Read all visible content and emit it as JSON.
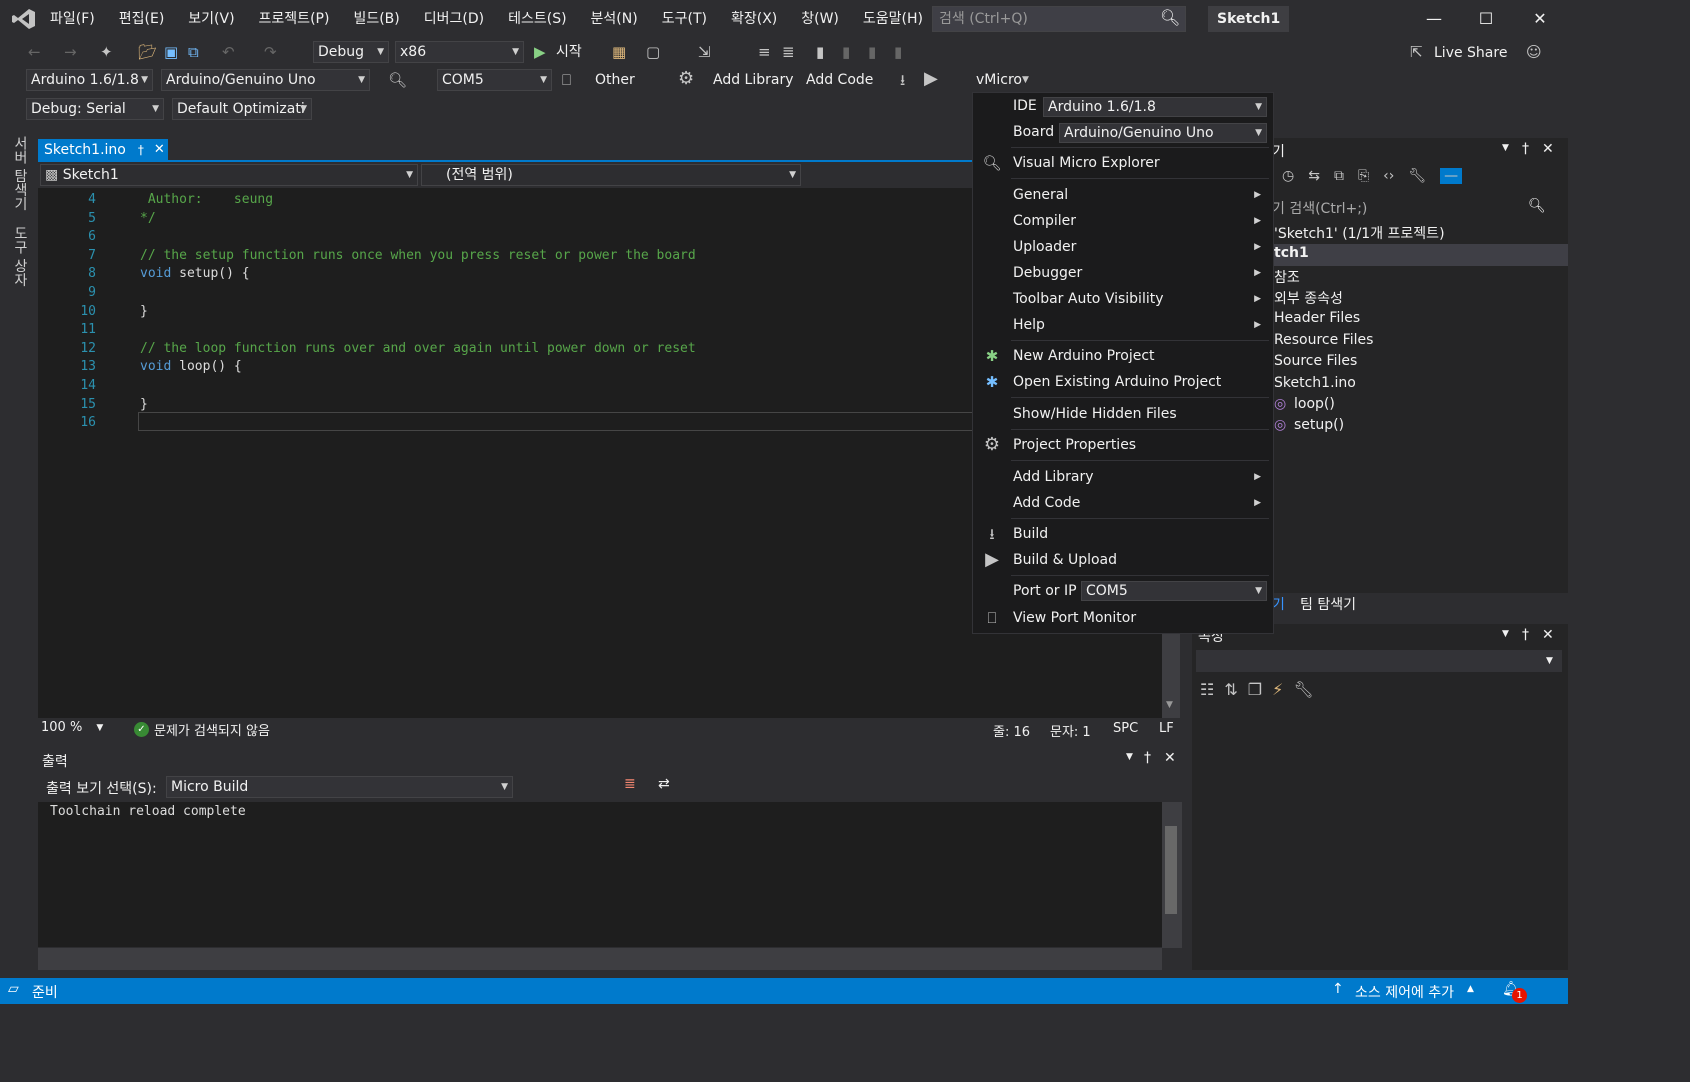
{
  "menubar": {
    "items": [
      "파일(F)",
      "편집(E)",
      "보기(V)",
      "프로젝트(P)",
      "빌드(B)",
      "디버그(D)",
      "테스트(S)",
      "분석(N)",
      "도구(T)",
      "확장(X)",
      "창(W)",
      "도움말(H)"
    ],
    "search_placeholder": "검색 (Ctrl+Q)",
    "window_title": "Sketch1",
    "live_share": "Live Share"
  },
  "toolbar1": {
    "config": "Debug",
    "platform": "x86",
    "start": "시작"
  },
  "toolbar2": {
    "ide": "Arduino 1.6/1.8",
    "board": "Arduino/Genuino Uno",
    "port": "COM5",
    "other": "Other",
    "add_library": "Add Library",
    "add_code": "Add Code",
    "vmicro": "vMicro"
  },
  "toolbar3": {
    "debug": "Debug: Serial",
    "optimization": "Default Optimizati"
  },
  "left_tabs": [
    "서버 탐색기",
    "도구 상자"
  ],
  "editor": {
    "tab_label": "Sketch1.ino",
    "nav_project": "Sketch1",
    "nav_scope": "(전역 범위)",
    "lines": [
      {
        "n": "4",
        "text": " Author:    seung",
        "cls": "cmt"
      },
      {
        "n": "5",
        "text": "*/",
        "cls": "cmt"
      },
      {
        "n": "6",
        "text": "",
        "cls": "plain"
      },
      {
        "n": "7",
        "text": "// the setup function runs once when you press reset or power the board",
        "cls": "cmt"
      },
      {
        "n": "8",
        "text_kw": "void",
        "text": " setup() {",
        "cls": "plain"
      },
      {
        "n": "9",
        "text": "",
        "cls": "plain"
      },
      {
        "n": "10",
        "text": "}",
        "cls": "plain"
      },
      {
        "n": "11",
        "text": "",
        "cls": "plain"
      },
      {
        "n": "12",
        "text": "// the loop function runs over and over again until power down or reset",
        "cls": "cmt"
      },
      {
        "n": "13",
        "text_kw": "void",
        "text": " loop() {",
        "cls": "plain"
      },
      {
        "n": "14",
        "text": "",
        "cls": "plain"
      },
      {
        "n": "15",
        "text": "}",
        "cls": "plain"
      },
      {
        "n": "16",
        "text": "",
        "cls": "plain"
      }
    ],
    "zoom": "100 %",
    "no_issues": "문제가 검색되지 않음",
    "line_info": "줄: 16",
    "char_info": "문자: 1",
    "spc": "SPC",
    "lf": "LF"
  },
  "output": {
    "title": "출력",
    "show_from_label": "출력 보기 선택(S):",
    "show_from_value": "Micro Build",
    "text": "Toolchain reload complete"
  },
  "solution": {
    "title_fragment": "기",
    "search_placeholder": "기 검색(Ctrl+;)",
    "items": [
      "'Sketch1' (1/1개 프로젝트)",
      "tch1",
      "참조",
      "외부 종속성",
      "Header Files",
      "Resource Files",
      "Source Files",
      "Sketch1.ino",
      "loop()",
      "setup()"
    ],
    "tab_a": "기",
    "tab_b": "팀 탐색기"
  },
  "properties": {
    "title": "속성"
  },
  "vmenu": {
    "ide_label": "IDE",
    "ide_value": "Arduino 1.6/1.8",
    "board_label": "Board",
    "board_value": "Arduino/Genuino Uno",
    "explorer": "Visual Micro Explorer",
    "general": "General",
    "compiler": "Compiler",
    "uploader": "Uploader",
    "debugger": "Debugger",
    "toolbar_auto": "Toolbar Auto Visibility",
    "help": "Help",
    "new_project": "New Arduino Project",
    "open_project": "Open Existing Arduino Project",
    "show_hide": "Show/Hide Hidden Files",
    "project_props": "Project Properties",
    "add_library": "Add Library",
    "add_code": "Add Code",
    "build": "Build",
    "build_upload": "Build & Upload",
    "port_label": "Port or IP",
    "port_value": "COM5",
    "port_monitor": "View Port Monitor"
  },
  "statusbar": {
    "ready": "준비",
    "source_control": "소스 제어에 추가",
    "notif_count": "1"
  }
}
